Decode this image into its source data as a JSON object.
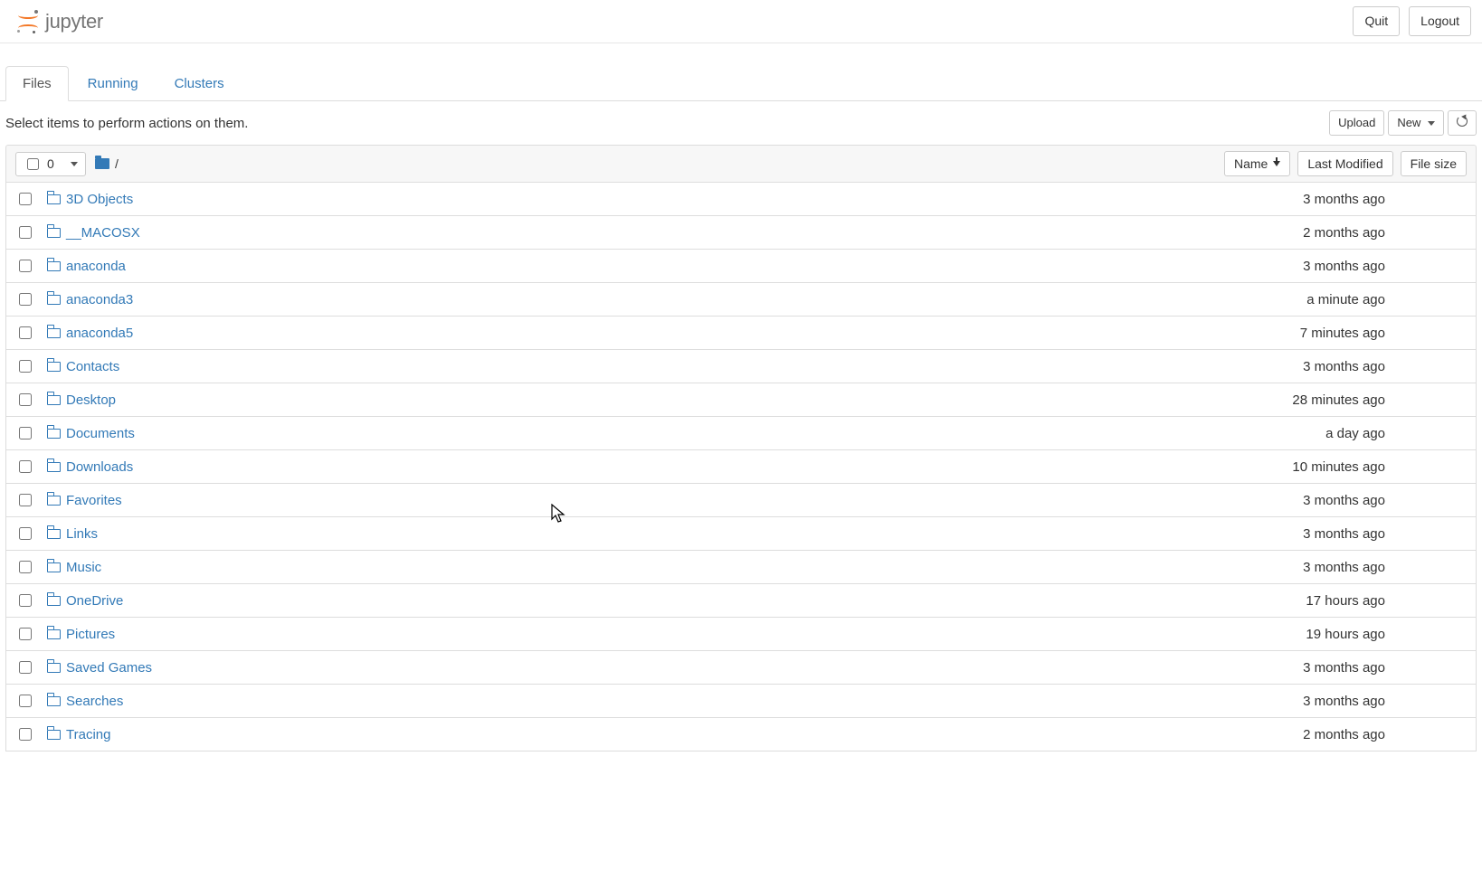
{
  "header": {
    "app_name": "jupyter",
    "quit_label": "Quit",
    "logout_label": "Logout"
  },
  "tabs": {
    "files": "Files",
    "running": "Running",
    "clusters": "Clusters",
    "active": "files"
  },
  "toolbar": {
    "hint": "Select items to perform actions on them.",
    "upload_label": "Upload",
    "new_label": "New"
  },
  "list_header": {
    "selected_count": "0",
    "breadcrumb_root": "/",
    "name_label": "Name",
    "last_modified_label": "Last Modified",
    "file_size_label": "File size"
  },
  "items": [
    {
      "name": "3D Objects",
      "modified": "3 months ago",
      "size": ""
    },
    {
      "name": "__MACOSX",
      "modified": "2 months ago",
      "size": ""
    },
    {
      "name": "anaconda",
      "modified": "3 months ago",
      "size": ""
    },
    {
      "name": "anaconda3",
      "modified": "a minute ago",
      "size": ""
    },
    {
      "name": "anaconda5",
      "modified": "7 minutes ago",
      "size": ""
    },
    {
      "name": "Contacts",
      "modified": "3 months ago",
      "size": ""
    },
    {
      "name": "Desktop",
      "modified": "28 minutes ago",
      "size": ""
    },
    {
      "name": "Documents",
      "modified": "a day ago",
      "size": ""
    },
    {
      "name": "Downloads",
      "modified": "10 minutes ago",
      "size": ""
    },
    {
      "name": "Favorites",
      "modified": "3 months ago",
      "size": ""
    },
    {
      "name": "Links",
      "modified": "3 months ago",
      "size": ""
    },
    {
      "name": "Music",
      "modified": "3 months ago",
      "size": ""
    },
    {
      "name": "OneDrive",
      "modified": "17 hours ago",
      "size": ""
    },
    {
      "name": "Pictures",
      "modified": "19 hours ago",
      "size": ""
    },
    {
      "name": "Saved Games",
      "modified": "3 months ago",
      "size": ""
    },
    {
      "name": "Searches",
      "modified": "3 months ago",
      "size": ""
    },
    {
      "name": "Tracing",
      "modified": "2 months ago",
      "size": ""
    }
  ]
}
